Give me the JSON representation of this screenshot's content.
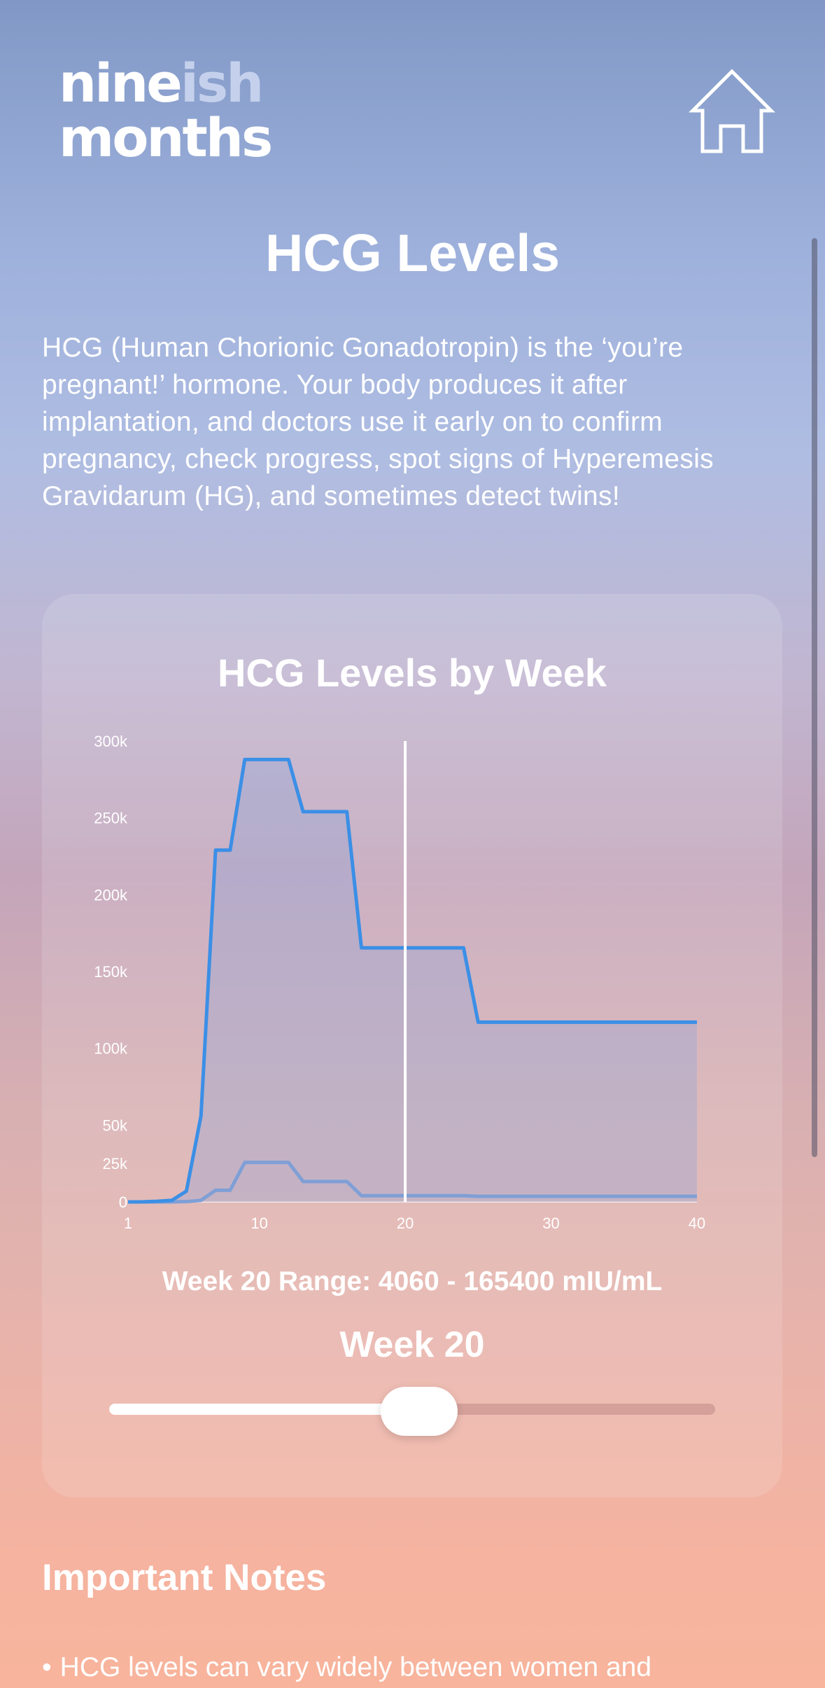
{
  "logo": {
    "line1_a": "nine",
    "line1_b": "ish",
    "line2": "months"
  },
  "header": {
    "home_icon": "home-icon"
  },
  "page": {
    "title": "HCG Levels",
    "intro": "HCG (Human Chorionic Gonadotropin) is the ‘you’re pregnant!’ hormone. Your body produces it after implantation, and doctors use it early on to confirm pregnancy, check progress, spot signs of Hyperemesis Gravidarum (HG), and sometimes detect twins!"
  },
  "chart_card": {
    "title": "HCG Levels by Week",
    "range_text": "Week 20 Range: 4060 - 165400 mIU/mL",
    "week_label": "Week 20",
    "slider": {
      "min": 1,
      "max": 40,
      "value": 20
    }
  },
  "chart_data": {
    "type": "area",
    "title": "HCG Levels by Week",
    "xlabel": "",
    "ylabel": "",
    "xlim": [
      1,
      40
    ],
    "ylim": [
      0,
      300000
    ],
    "x_ticks": [
      1,
      10,
      20,
      30,
      40
    ],
    "y_ticks": [
      {
        "value": 0,
        "label": "0"
      },
      {
        "value": 25000,
        "label": "25k"
      },
      {
        "value": 50000,
        "label": "50k"
      },
      {
        "value": 100000,
        "label": "100k"
      },
      {
        "value": 150000,
        "label": "150k"
      },
      {
        "value": 200000,
        "label": "200k"
      },
      {
        "value": 250000,
        "label": "250k"
      },
      {
        "value": 300000,
        "label": "300k"
      }
    ],
    "selected_week": 20,
    "colors": {
      "upper": "#3b8fe6",
      "lower": "#7f9fd6",
      "fill": "#8fa3d6",
      "marker": "#ffffff"
    },
    "series": [
      {
        "x": [
          1,
          2,
          3,
          4,
          5,
          6,
          7,
          8,
          9,
          10,
          11,
          12,
          13,
          14,
          15,
          16,
          17,
          18,
          19,
          20,
          21,
          22,
          23,
          24,
          25,
          26,
          27,
          28,
          29,
          30,
          31,
          32,
          33,
          34,
          35,
          36,
          37,
          38,
          39,
          40
        ],
        "values": [
          5,
          50,
          400,
          1000,
          7000,
          56000,
          229000,
          229000,
          288000,
          288000,
          288000,
          288000,
          254000,
          254000,
          254000,
          254000,
          165400,
          165400,
          165400,
          165400,
          165400,
          165400,
          165400,
          165400,
          117000,
          117000,
          117000,
          117000,
          117000,
          117000,
          117000,
          117000,
          117000,
          117000,
          117000,
          117000,
          117000,
          117000,
          117000,
          117000
        ]
      },
      {
        "x": [
          1,
          2,
          3,
          4,
          5,
          6,
          7,
          8,
          9,
          10,
          11,
          12,
          13,
          14,
          15,
          16,
          17,
          18,
          19,
          20,
          21,
          22,
          23,
          24,
          25,
          26,
          27,
          28,
          29,
          30,
          31,
          32,
          33,
          34,
          35,
          36,
          37,
          38,
          39,
          40
        ],
        "values": [
          0,
          5,
          5,
          10,
          200,
          1000,
          7600,
          7600,
          25700,
          25700,
          25700,
          25700,
          13300,
          13300,
          13300,
          13300,
          4060,
          4060,
          4060,
          4060,
          4060,
          4060,
          4060,
          4060,
          3640,
          3640,
          3640,
          3640,
          3640,
          3640,
          3640,
          3640,
          3640,
          3640,
          3640,
          3640,
          3640,
          3640,
          3640,
          3640
        ]
      }
    ]
  },
  "notes": {
    "heading": "Important Notes",
    "items": [
      "HCG levels can vary widely between women and"
    ]
  }
}
